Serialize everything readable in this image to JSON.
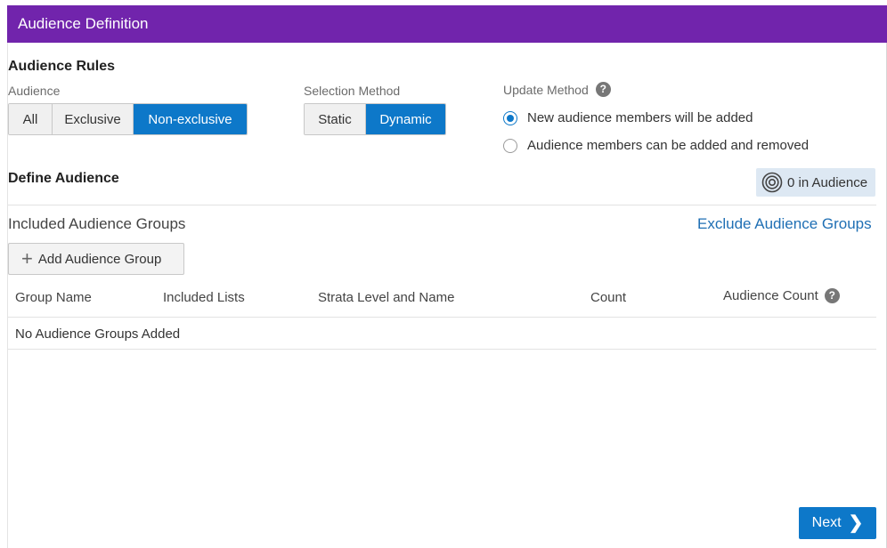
{
  "header": {
    "title": "Audience Definition"
  },
  "audience_rules": {
    "title": "Audience Rules",
    "audience": {
      "label": "Audience",
      "options": [
        "All",
        "Exclusive",
        "Non-exclusive"
      ],
      "selected": "Non-exclusive"
    },
    "selection_method": {
      "label": "Selection Method",
      "options": [
        "Static",
        "Dynamic"
      ],
      "selected": "Dynamic"
    },
    "update_method": {
      "label": "Update Method",
      "help_icon": "?",
      "options": [
        "New audience members will be added",
        "Audience members can be added and removed"
      ],
      "selected": "New audience members will be added"
    }
  },
  "define_audience": {
    "title": "Define Audience",
    "count_badge": "0 in Audience",
    "included_heading": "Included Audience Groups",
    "exclude_link": "Exclude Audience Groups",
    "add_button": "Add Audience Group",
    "table": {
      "columns": [
        "Group Name",
        "Included Lists",
        "Strata Level and Name",
        "Count",
        "Audience Count"
      ],
      "help_icon": "?",
      "empty_message": "No Audience Groups Added"
    }
  },
  "footer": {
    "next_label": "Next"
  },
  "colors": {
    "header": "#7124ac",
    "accent": "#0d78c9",
    "link": "#1f6fb4",
    "badge_bg": "#dde8f3"
  }
}
